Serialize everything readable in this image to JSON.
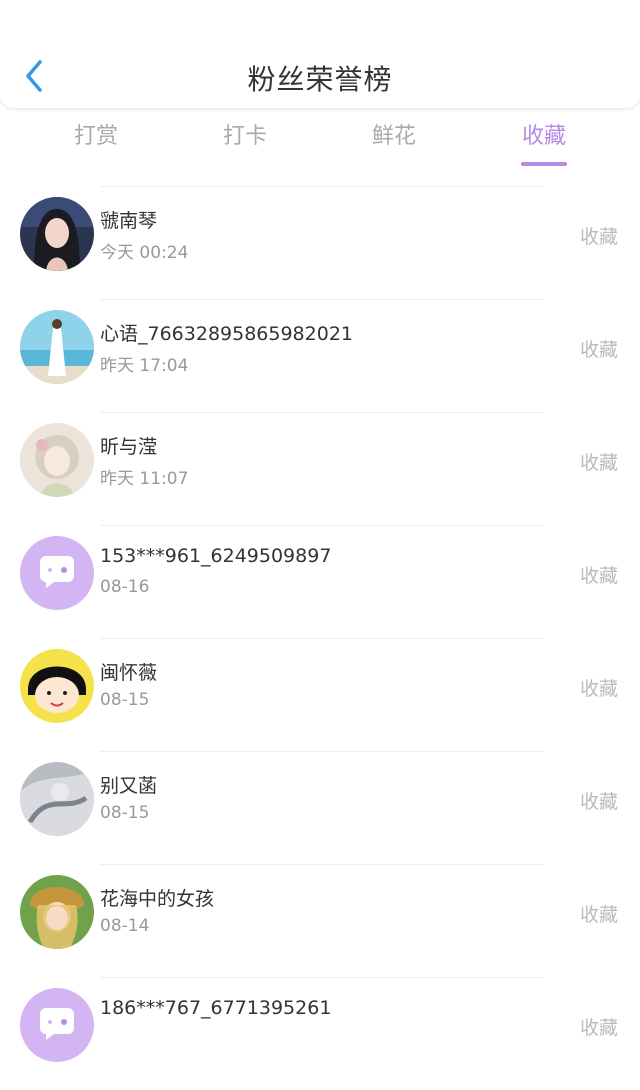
{
  "header": {
    "title": "粉丝荣誉榜"
  },
  "tabs": [
    {
      "label": "打赏"
    },
    {
      "label": "打卡"
    },
    {
      "label": "鲜花"
    },
    {
      "label": "收藏"
    }
  ],
  "active_tab": "收藏",
  "accent_color": "#b58be6",
  "rows": [
    {
      "name": "虢南琴",
      "time": "今天 00:24",
      "action": "收藏"
    },
    {
      "name": "心语_76632895865982021",
      "time": "昨天 17:04",
      "action": "收藏"
    },
    {
      "name": "昕与滢",
      "time": "昨天 11:07",
      "action": "收藏"
    },
    {
      "name": "153***961_6249509897",
      "time": "08-16",
      "action": "收藏"
    },
    {
      "name": "闽怀薇",
      "time": "08-15",
      "action": "收藏"
    },
    {
      "name": "别又菡",
      "time": "08-15",
      "action": "收藏"
    },
    {
      "name": "花海中的女孩",
      "time": "08-14",
      "action": "收藏"
    },
    {
      "name": "186***767_6771395261",
      "time": "",
      "action": "收藏"
    }
  ]
}
